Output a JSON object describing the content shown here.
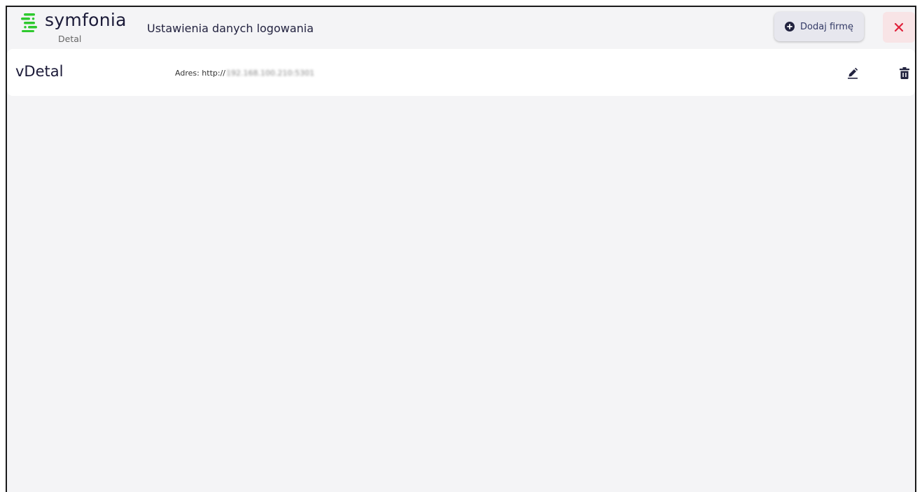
{
  "header": {
    "brand": "symfonia",
    "product": "Detal",
    "title": "Ustawienia danych logowania",
    "add_company_label": "Dodaj firmę"
  },
  "companies": [
    {
      "name": "vDetal",
      "address_label": "Adres: http://",
      "address_value": "192.168.100.210:5301"
    }
  ],
  "colors": {
    "brand_green": "#2ec92e",
    "brand_dark": "#1b1a38",
    "close_red": "#e0203a",
    "close_bg": "#f8e4e6",
    "page_bg": "#f4f4f6"
  },
  "icons": {
    "logo": "symfonia-logo-icon",
    "add": "plus-circle-icon",
    "close": "close-icon",
    "edit": "pencil-icon",
    "delete": "trash-icon"
  }
}
